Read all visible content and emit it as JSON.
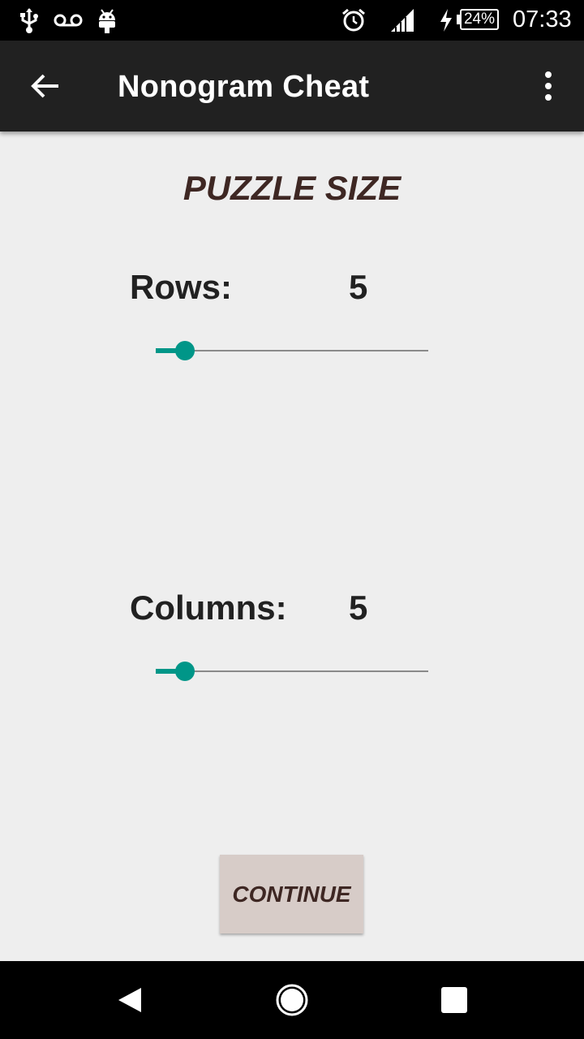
{
  "status_bar": {
    "icons": [
      "usb-icon",
      "voicemail-icon",
      "android-icon",
      "alarm-icon",
      "signal-icon",
      "charging-icon"
    ],
    "battery": "24%",
    "time": "07:33"
  },
  "app_bar": {
    "title": "Nonogram Cheat",
    "back_icon": "arrow-back-icon",
    "overflow_icon": "more-vert-icon"
  },
  "main": {
    "heading": "PUZZLE SIZE",
    "rows": {
      "label": "Rows:",
      "value": "5",
      "slider_fraction": 0.107
    },
    "columns": {
      "label": "Columns:",
      "value": "5",
      "slider_fraction": 0.107
    },
    "continue_label": "CONTINUE"
  },
  "nav_bar": {
    "icons": [
      "back-triangle-icon",
      "home-circle-icon",
      "recents-square-icon"
    ]
  },
  "colors": {
    "accent": "#009688",
    "heading": "#3e2723",
    "button_bg": "#d7ccc8",
    "app_bar": "#212121",
    "background": "#eeeeee"
  }
}
